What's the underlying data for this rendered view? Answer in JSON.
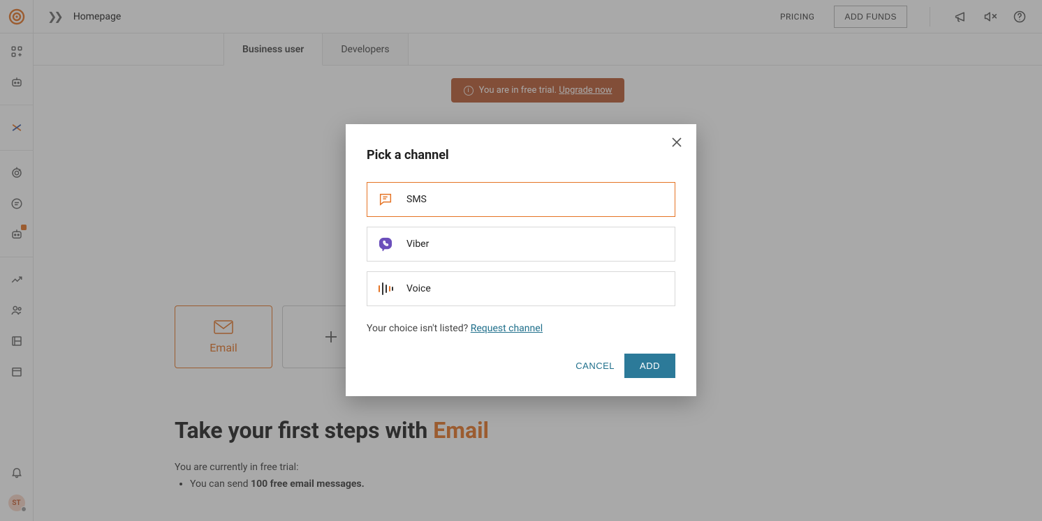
{
  "header": {
    "breadcrumb_label": "Homepage",
    "pricing_label": "PRICING",
    "add_funds_label": "ADD FUNDS"
  },
  "siderail": {
    "avatar_initials": "ST"
  },
  "tabs": {
    "business_label": "Business user",
    "developers_label": "Developers"
  },
  "trial_banner": {
    "text": "You are in free trial.",
    "link_label": "Upgrade now"
  },
  "onboard": {
    "email_card_label": "Email",
    "heading_prefix": "Take your first steps with ",
    "heading_accent": "Email",
    "subtext": "You are currently in free trial:",
    "bullet_prefix": "You can send ",
    "bullet_bold": "100 free email messages."
  },
  "modal": {
    "title": "Pick a channel",
    "channels": {
      "sms": "SMS",
      "viber": "Viber",
      "voice": "Voice"
    },
    "note_prefix": "Your choice isn't listed? ",
    "note_link": "Request channel",
    "cancel_label": "CANCEL",
    "add_label": "ADD"
  }
}
